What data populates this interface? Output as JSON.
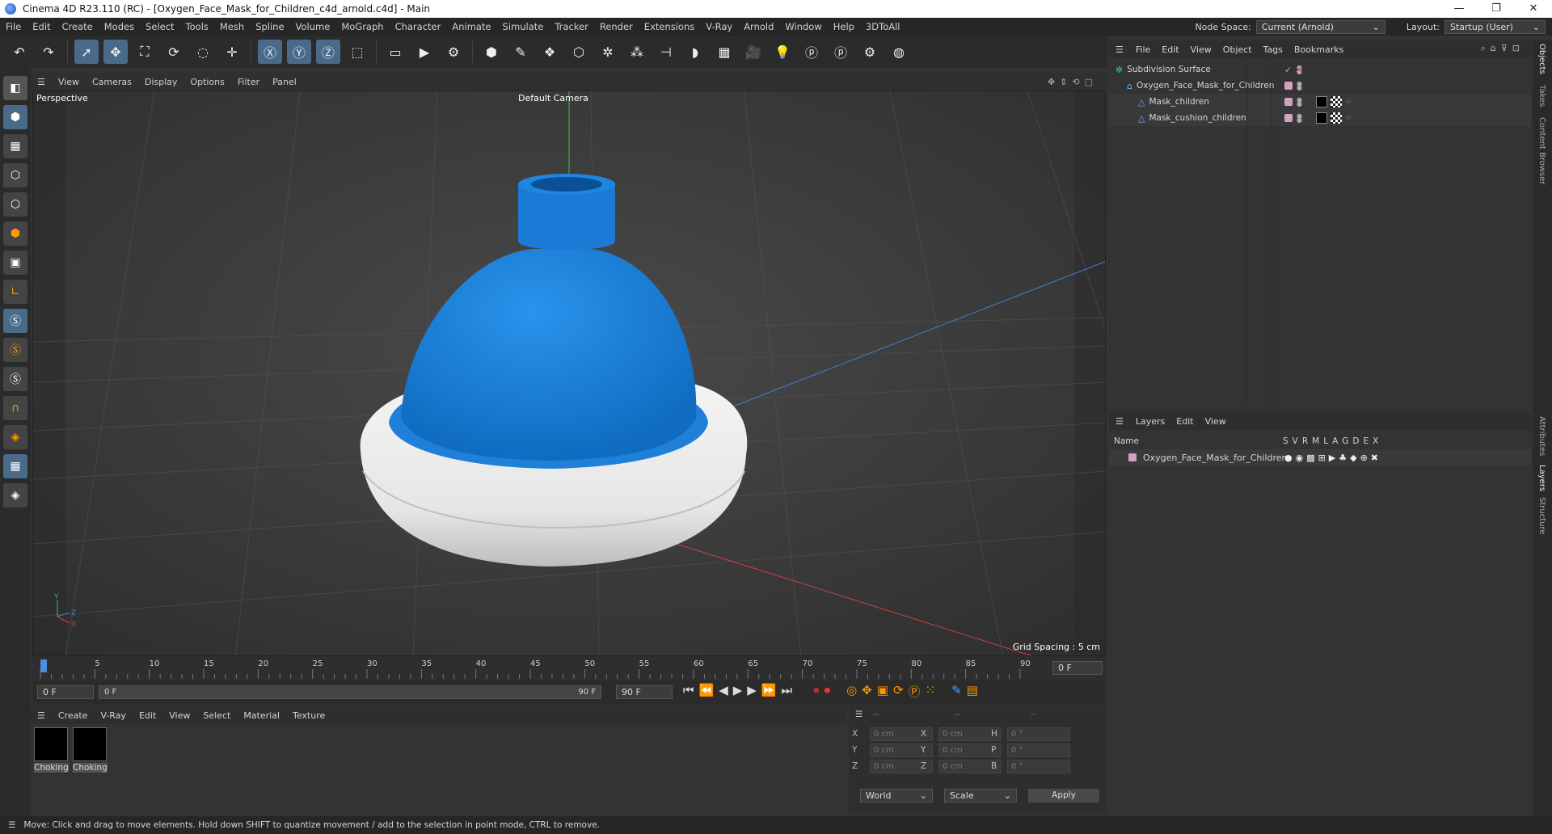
{
  "window": {
    "title": "Cinema 4D R23.110 (RC) - [Oxygen_Face_Mask_for_Children_c4d_arnold.c4d] - Main",
    "controls": [
      "—",
      "❐",
      "✕"
    ]
  },
  "menubar": {
    "items": [
      "File",
      "Edit",
      "Create",
      "Modes",
      "Select",
      "Tools",
      "Mesh",
      "Spline",
      "Volume",
      "MoGraph",
      "Character",
      "Animate",
      "Simulate",
      "Tracker",
      "Render",
      "Extensions",
      "V-Ray",
      "Arnold",
      "Window",
      "Help",
      "3DToAll"
    ],
    "node_space_label": "Node Space:",
    "node_space_value": "Current (Arnold)",
    "layout_label": "Layout:",
    "layout_value": "Startup (User)"
  },
  "toolbar": {
    "icons": [
      "undo-icon",
      "redo-icon",
      "select-icon",
      "move-icon",
      "scale-icon",
      "rotate-icon",
      "last-tool-icon",
      "add-icon",
      "x-axis-icon",
      "y-axis-icon",
      "z-axis-icon",
      "world-coord-icon",
      "render-region-icon",
      "render-view-icon",
      "render-settings-icon",
      "cube-icon",
      "pen-icon",
      "subdivision-icon",
      "extrude-icon",
      "cloner-icon",
      "array-icon",
      "symmetry-icon",
      "deformer-icon",
      "floor-icon",
      "camera-icon",
      "light-icon",
      "python-icon",
      "python2-icon",
      "gear-icon",
      "globe-icon"
    ]
  },
  "viewport": {
    "menu": [
      "Cameras",
      "Display",
      "Options",
      "Filter",
      "Panel"
    ],
    "view_label": "View",
    "name": "Perspective",
    "camera": "Default Camera",
    "grid_spacing": "Grid Spacing : 5 cm"
  },
  "timeline": {
    "ticks": [
      "0",
      "5",
      "10",
      "15",
      "20",
      "25",
      "30",
      "35",
      "40",
      "45",
      "50",
      "55",
      "60",
      "65",
      "70",
      "75",
      "80",
      "85",
      "90"
    ],
    "current": "0 F"
  },
  "transport": {
    "start": "0 F",
    "range_start": "0 F",
    "range_end": "90 F",
    "end": "90 F"
  },
  "material": {
    "menu": [
      "Create",
      "V-Ray",
      "Edit",
      "View",
      "Select",
      "Material",
      "Texture"
    ],
    "items": [
      {
        "name": "Choking"
      },
      {
        "name": "Choking"
      }
    ]
  },
  "coords": {
    "headers": [
      "--",
      "--",
      "--"
    ],
    "rows": [
      {
        "a": "X",
        "av": "0 cm",
        "b": "X",
        "bv": "0 cm",
        "c": "H",
        "cv": "0 °"
      },
      {
        "a": "Y",
        "av": "0 cm",
        "b": "Y",
        "bv": "0 cm",
        "c": "P",
        "cv": "0 °"
      },
      {
        "a": "Z",
        "av": "0 cm",
        "b": "Z",
        "bv": "0 cm",
        "c": "B",
        "cv": "0 °"
      }
    ],
    "world": "World",
    "scale": "Scale",
    "apply": "Apply"
  },
  "objects": {
    "menu": [
      "File",
      "Edit",
      "View",
      "Object",
      "Tags",
      "Bookmarks"
    ],
    "tree": [
      {
        "name": "Subdivision Surface",
        "indent": 0
      },
      {
        "name": "Oxygen_Face_Mask_for_Children",
        "indent": 1
      },
      {
        "name": "Mask_children",
        "indent": 2
      },
      {
        "name": "Mask_cushion_children",
        "indent": 2
      }
    ]
  },
  "layers": {
    "menu": [
      "Layers",
      "Edit",
      "View"
    ],
    "col_name": "Name",
    "cols": [
      "S",
      "V",
      "R",
      "M",
      "L",
      "A",
      "G",
      "D",
      "E",
      "X"
    ],
    "items": [
      {
        "name": "Oxygen_Face_Mask_for_Children"
      }
    ]
  },
  "siderail": {
    "tabs": [
      "Objects",
      "Takes",
      "Content Browser",
      "Attributes",
      "Layers",
      "Structure"
    ]
  },
  "status": "Move: Click and drag to move elements. Hold down SHIFT to quantize movement / add to the selection in point mode, CTRL to remove."
}
